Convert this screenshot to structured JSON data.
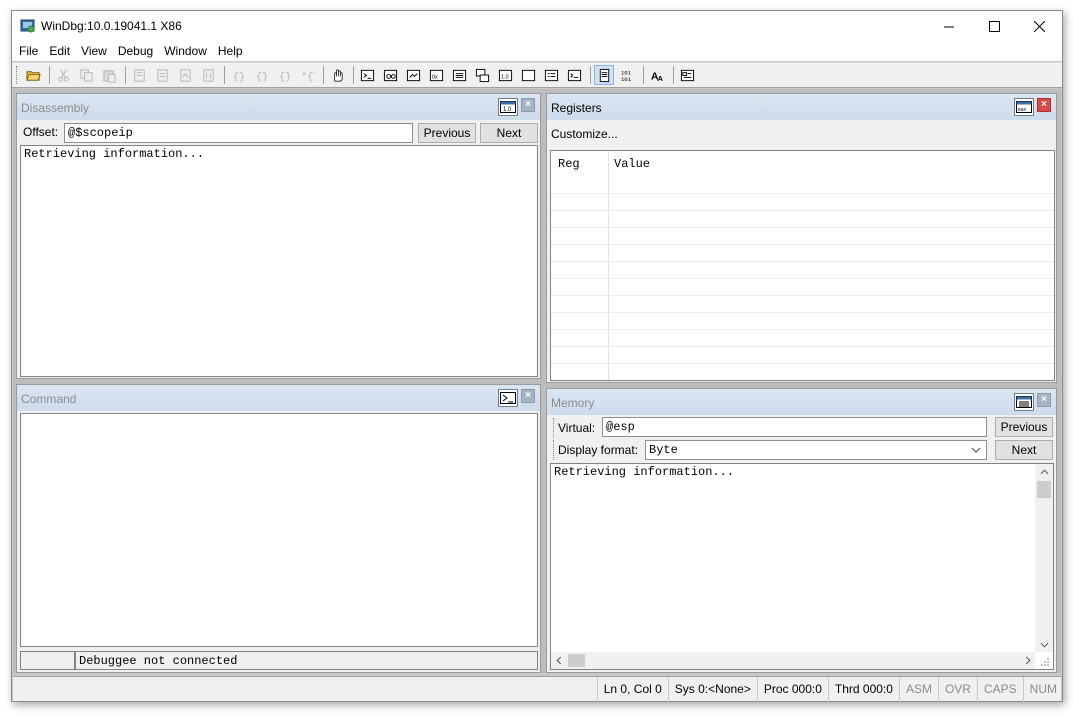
{
  "window": {
    "title": "WinDbg:10.0.19041.1 X86"
  },
  "menu": [
    "File",
    "Edit",
    "View",
    "Debug",
    "Window",
    "Help"
  ],
  "toolbar_icons": [
    "open-icon",
    "cut-icon",
    "copy-icon",
    "paste-icon",
    "source-mode-icon",
    "breakpoint-list-icon",
    "go-icon",
    "break-icon",
    "step-into-icon",
    "step-over-icon",
    "step-out-icon",
    "run-to-cursor-icon",
    "hand-icon",
    "command-window-icon",
    "watch-window-icon",
    "locals-window-icon",
    "registers-window-icon",
    "memory-window-icon",
    "call-stack-icon",
    "disassembly-window-icon",
    "scratch-pad-icon",
    "processes-threads-icon",
    "command-browser-icon",
    "source-mode-toggle-icon",
    "hex-display-icon",
    "font-icon",
    "options-icon"
  ],
  "disassembly": {
    "title": "Disassembly",
    "offset_label": "Offset:",
    "offset_value": "@$scopeip",
    "previous": "Previous",
    "next": "Next",
    "content": "Retrieving information..."
  },
  "registers": {
    "title": "Registers",
    "customize": "Customize...",
    "col_reg": "Reg",
    "col_value": "Value"
  },
  "command": {
    "title": "Command",
    "prompt_status": "Debuggee not connected"
  },
  "memory": {
    "title": "Memory",
    "virtual_label": "Virtual:",
    "virtual_value": "@esp",
    "previous": "Previous",
    "display_format_label": "Display format:",
    "display_format_value": "Byte",
    "next": "Next",
    "content": "Retrieving information..."
  },
  "status": {
    "ln_col": "Ln 0, Col 0",
    "sys": "Sys 0:<None>",
    "proc": "Proc 000:0",
    "thrd": "Thrd 000:0",
    "asm": "ASM",
    "ovr": "OVR",
    "caps": "CAPS",
    "num": "NUM"
  }
}
